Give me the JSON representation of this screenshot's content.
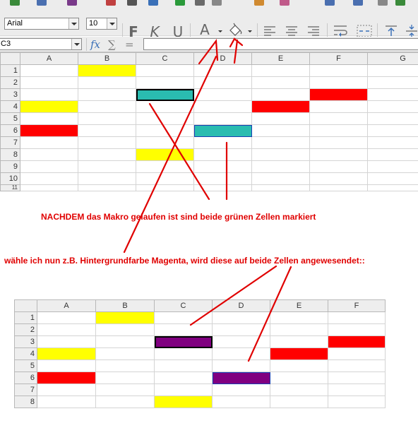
{
  "toolbar": {
    "font_name": "Arial",
    "font_size": "10",
    "bold_glyph": "F",
    "italic_glyph": "K",
    "underline_glyph": "U",
    "font_color_glyph": "A"
  },
  "formula_bar": {
    "name_box": "C3",
    "fx_glyph": "fx",
    "sum_glyph": "∑",
    "equals_glyph": "=",
    "formula_value": ""
  },
  "top_grid": {
    "columns": [
      "A",
      "B",
      "C",
      "D",
      "E",
      "F",
      "G"
    ],
    "rows": [
      "1",
      "2",
      "3",
      "4",
      "5",
      "6",
      "7",
      "8",
      "9",
      "10",
      "11"
    ]
  },
  "bottom_grid": {
    "columns": [
      "A",
      "B",
      "C",
      "D",
      "E",
      "F"
    ],
    "rows": [
      "1",
      "2",
      "3",
      "4",
      "5",
      "6",
      "7",
      "8"
    ]
  },
  "annotations": {
    "note_1": "NACHDEM das Makro gelaufen ist sind beide grünen Zellen markiert",
    "note_2": "wähle ich nun z.B. Hintergrundfarbe Magenta, wird diese auf beide Zellen angewesendet::"
  },
  "colors": {
    "yellow": "#ffff00",
    "red": "#ff0000",
    "teal": "#2abcb0",
    "magenta": "#800080",
    "annotation": "#e00000"
  }
}
